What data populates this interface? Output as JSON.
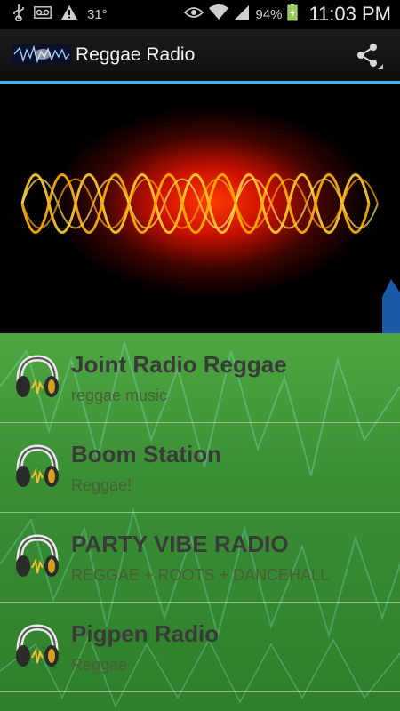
{
  "status_bar": {
    "temperature": "31°",
    "battery_percent": "94%",
    "time": "11:03 PM",
    "icons": [
      "usb-icon",
      "voicemail-icon",
      "warning-icon",
      "eye-icon",
      "wifi-icon",
      "signal-icon",
      "battery-icon"
    ]
  },
  "action_bar": {
    "title": "Reggae Radio",
    "share_icon": "share-icon",
    "accent_color": "#33b5e5"
  },
  "stations": [
    {
      "name": "Joint Radio Reggae",
      "description": "reggae music"
    },
    {
      "name": "Boom Station",
      "description": "Reggae!"
    },
    {
      "name": "PARTY VIBE RADIO",
      "description": "REGGAE  +  ROOTS + DANCEHALL"
    },
    {
      "name": "Pigpen Radio",
      "description": "Reggae"
    }
  ],
  "colors": {
    "list_green": "#3a8e34",
    "title_text": "#3a3a3a"
  }
}
